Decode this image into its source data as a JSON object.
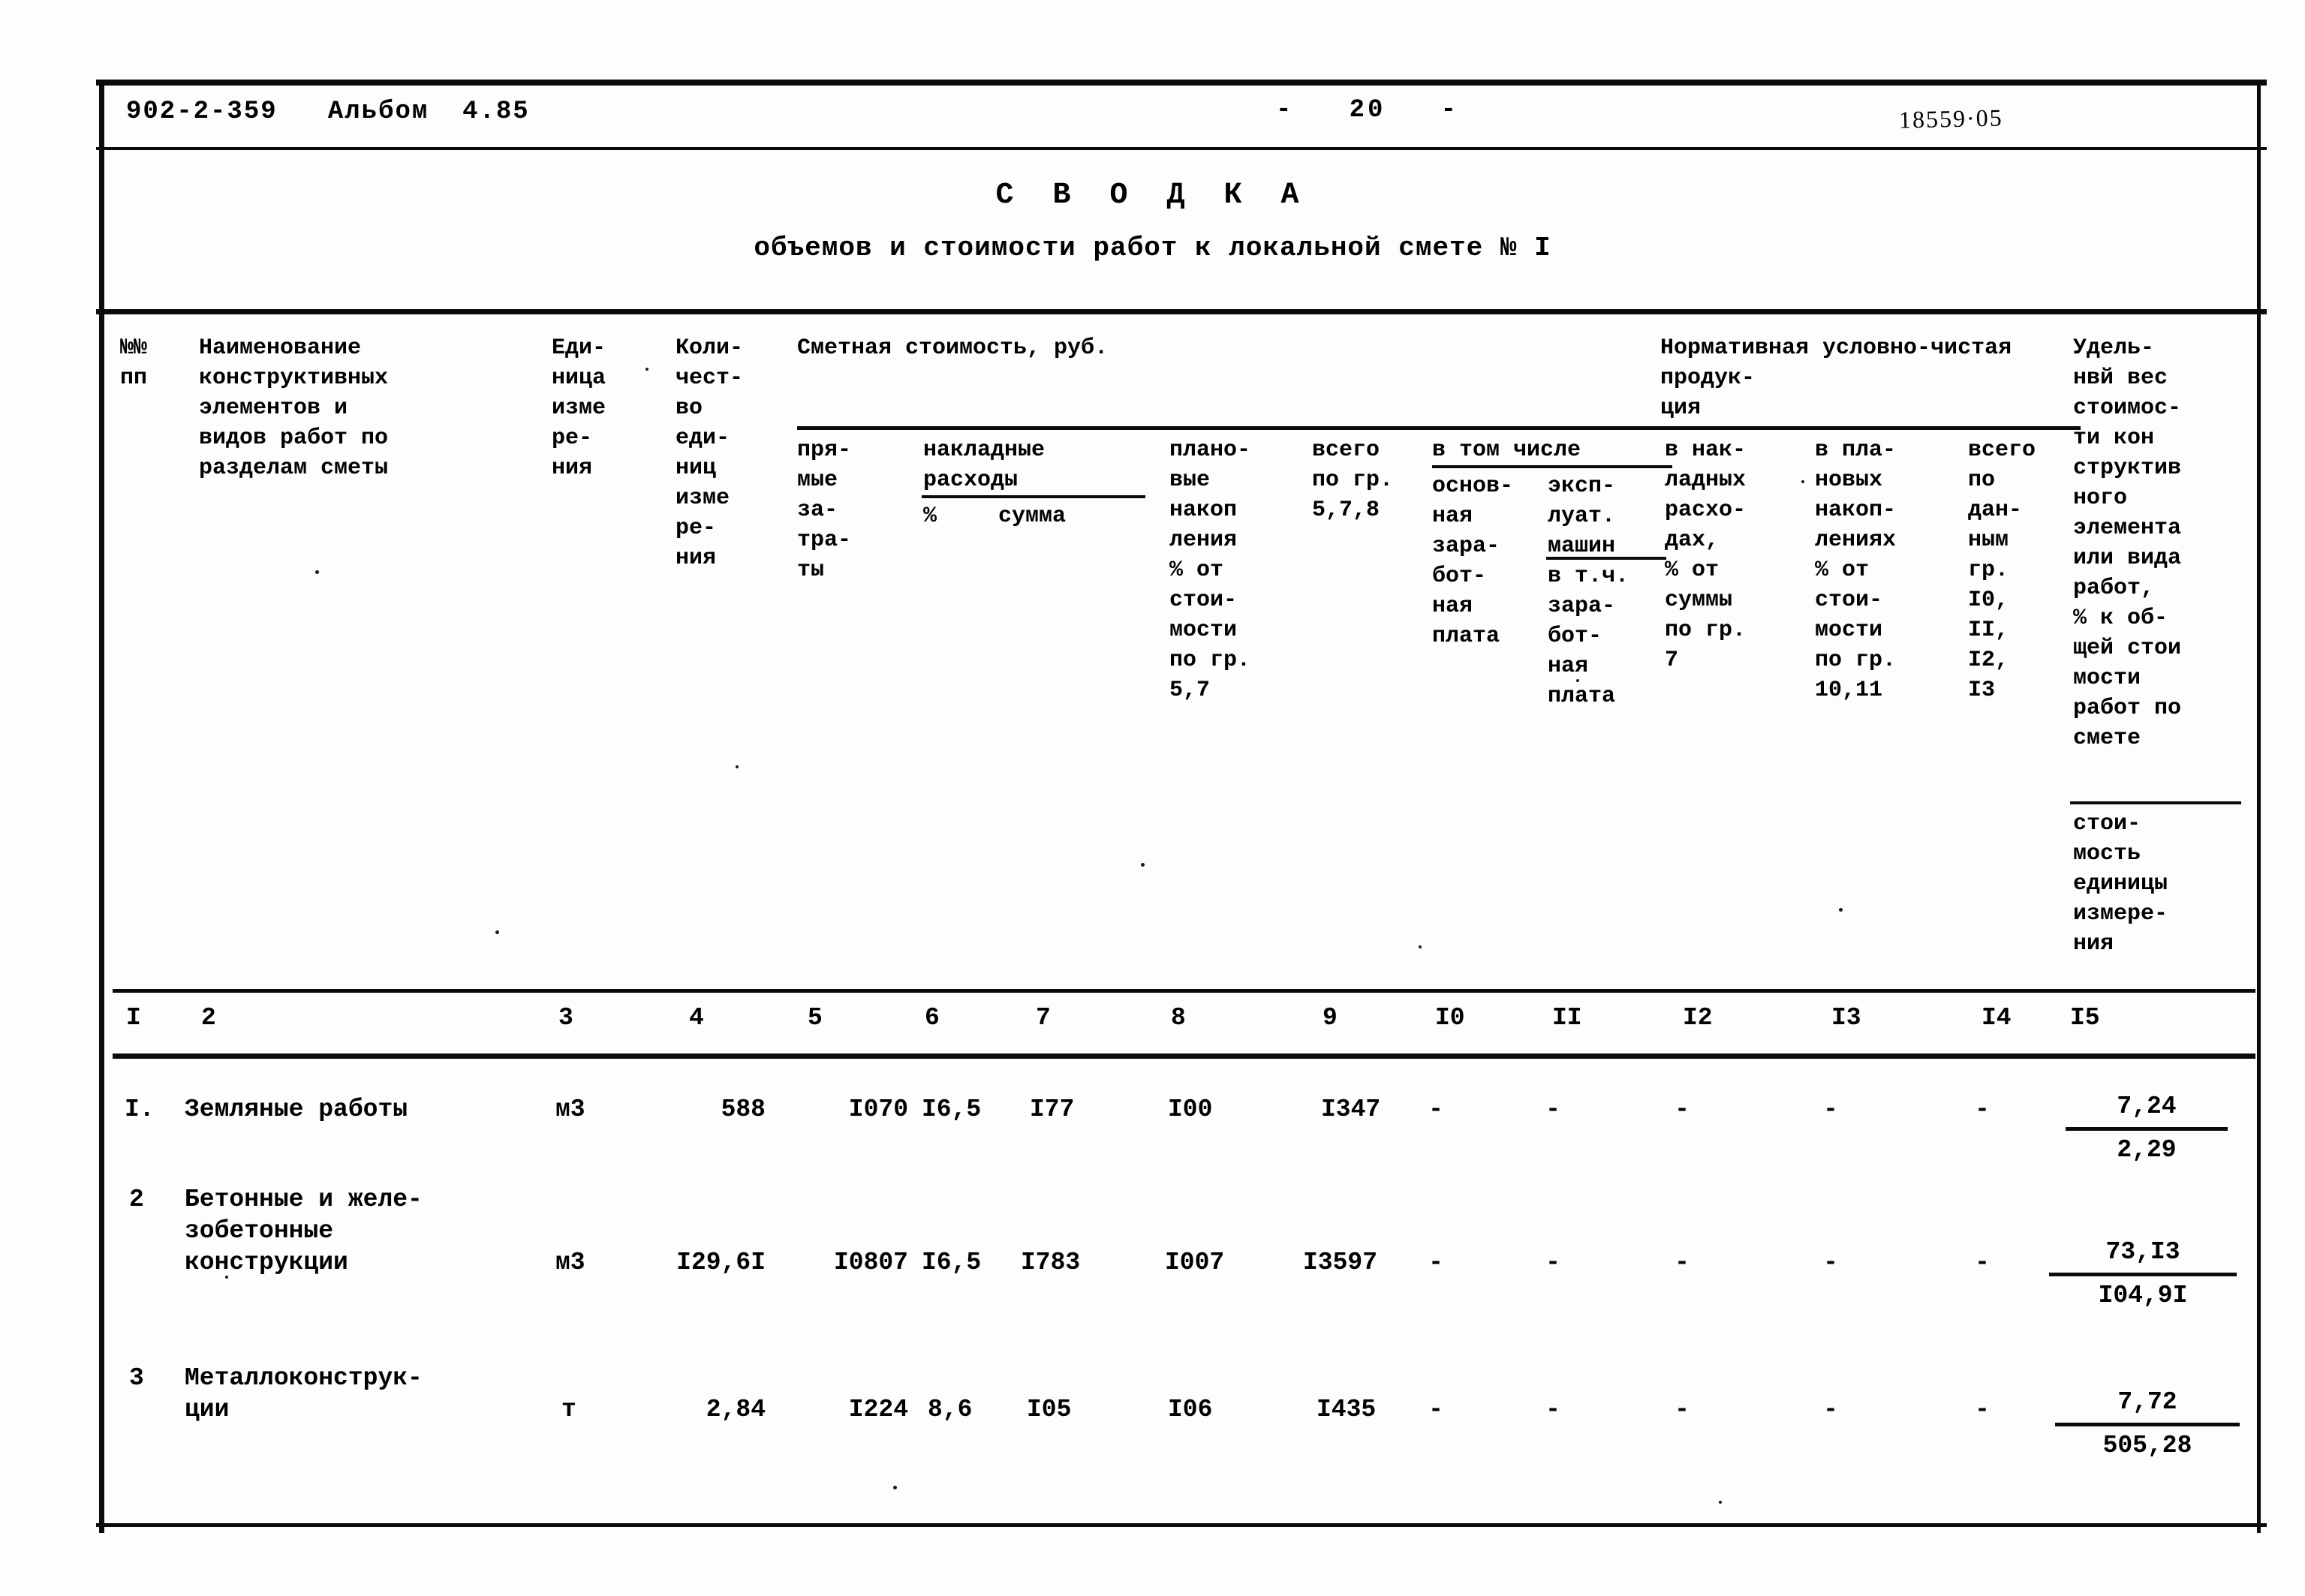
{
  "header": {
    "doc_code": "902-2-359   Альбом  4.85",
    "page_number": "-   20   -",
    "stamp_number": "18559·05"
  },
  "title": {
    "main": "С В О Д К А",
    "subtitle": "объемов и стоимости работ к локальной смете № I"
  },
  "table_header": {
    "c1": "№№\nпп",
    "c2": "Наименование\nконструктивных\nэлементов и\nвидов работ по\nразделам сметы",
    "c3": "Еди-\nница\nизме\nре-\nния",
    "c4": "Коли-\nчест-\nво\nеди-\nниц\nизме\nре-\nния",
    "group_smeta": "Сметная стоимость, руб.",
    "c5": "пря-\nмые\nза-\nтра-\nты",
    "group_nakl": "накладные\nрасходы",
    "c6": "%",
    "c7": "сумма",
    "c8": "плано-\nвые\nнакоп\nления\n% от\nстои-\nмости\nпо гр.\n5,7",
    "c9": "всего\nпо гр.\n5,7,8",
    "group_vtom": "в том числе",
    "c10": "основ-\nная\nзара-\nбот-\nная\nплата",
    "c11_a": "эксп-\nлуат.\nмашин",
    "c11_b": "в т.ч.\nзара-\nбот-\nная\nплата",
    "group_nucp": "Нормативная условно-чистая продук-\nция",
    "c12": "в нак-\nладных\nрасхо-\nдах,\n% от\nсуммы\nпо гр.\n7",
    "c13": "в пла-\nновых\nнакоп-\nлениях\n% от\nстои-\nмости\nпо гр.\n10,11",
    "c14": "всего\nпо\nдан-\nным\nгр.\nI0,\nII,\nI2,\nI3",
    "c15_top": "Удель-\nнвй вес\nстоимос-\nти кон\nструктив\nного\nэлемента\nили вида\nработ,\n% к об-\nщей стои\nмости\nработ по\nсмете",
    "c15_bot": "стои-\nмость\nединицы\nизмере-\nния"
  },
  "column_numbers": [
    "I",
    "2",
    "3",
    "4",
    "5",
    "6",
    "7",
    "8",
    "9",
    "I0",
    "II",
    "I2",
    "I3",
    "I4",
    "I5"
  ],
  "rows": [
    {
      "no": "I.",
      "name": "Земляные работы",
      "unit": "м3",
      "qty": "588",
      "direct": "I070",
      "ovh_pct": "I6,5",
      "ovh_sum": "I77",
      "plan_accum": "I00",
      "total": "I347",
      "c10": "-",
      "c11": "-",
      "c12": "-",
      "c13": "-",
      "c14": "-",
      "weight_pct": "7,24",
      "unit_cost": "2,29"
    },
    {
      "no": "2",
      "name": "Бетонные и желе-\nзобетонные\nконструкции",
      "unit": "м3",
      "qty": "I29,6I",
      "direct": "I0807",
      "ovh_pct": "I6,5",
      "ovh_sum": "I783",
      "plan_accum": "I007",
      "total": "I3597",
      "c10": "-",
      "c11": "-",
      "c12": "-",
      "c13": "-",
      "c14": "-",
      "weight_pct": "73,I3",
      "unit_cost": "I04,9I"
    },
    {
      "no": "3",
      "name": "Металлоконструк-\nции",
      "unit": "т",
      "qty": "2,84",
      "direct": "I224",
      "ovh_pct": "8,6",
      "ovh_sum": "I05",
      "plan_accum": "I06",
      "total": "I435",
      "c10": "-",
      "c11": "-",
      "c12": "-",
      "c13": "-",
      "c14": "-",
      "weight_pct": "7,72",
      "unit_cost": "505,28"
    }
  ]
}
